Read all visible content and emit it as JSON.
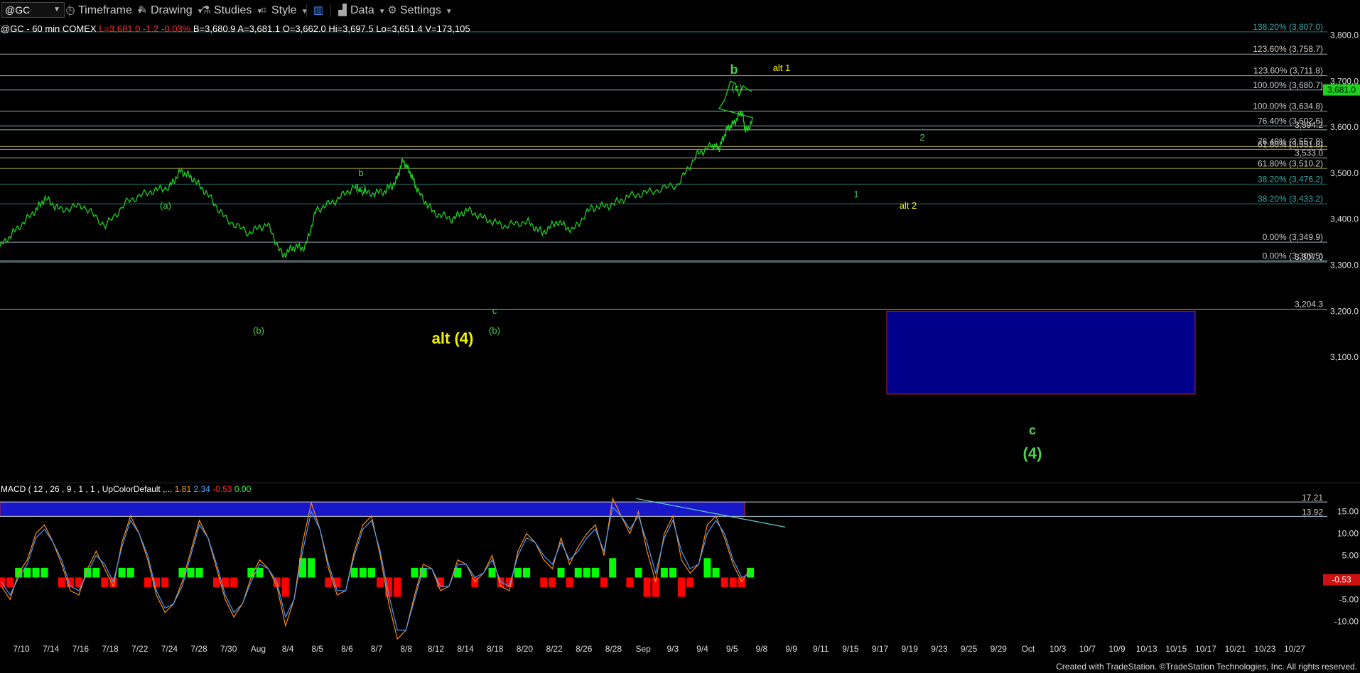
{
  "toolbar": {
    "symbol": "@GC",
    "items": [
      {
        "label": "Timeframe",
        "icon": "clock-icon"
      },
      {
        "label": "Drawing",
        "icon": "pencil-icon"
      },
      {
        "label": "Studies",
        "icon": "flask-icon"
      },
      {
        "label": "Style",
        "icon": "chart-style-icon"
      },
      {
        "label": "",
        "icon": "layout-icon"
      },
      {
        "label": "Data",
        "icon": "bar-chart-icon"
      },
      {
        "label": "Settings",
        "icon": "gear-icon"
      }
    ]
  },
  "quote": {
    "symbol_line": "@GC - 60 min  COMEX",
    "last": "L=3,681.0",
    "chg": "-1.2",
    "pct": "-0.03%",
    "bid": "B=3,680.9",
    "ask": "A=3,681.1",
    "open": "O=3,662.0",
    "hi": "Hi=3,697.5",
    "lo": "Lo=3,651.4",
    "vol": "V=173,105"
  },
  "macd_header": {
    "label": "MACD ( 12 , 26 , 9 , 1 , 1 , UpColorDefault ,...",
    "v1": "1.81",
    "v2": "2.34",
    "v3": "-0.53",
    "v4": "0.00"
  },
  "footer": "Created with TradeStation. ©TradeStation Technologies, Inc. All rights reserved.",
  "colors": {
    "price": "#1fd01f",
    "macd_line": "#ff8c1a",
    "signal_line": "#4a9cff",
    "hist_up": "#00ff00",
    "hist_down": "#ff0000",
    "box": "#00008b",
    "wave_green": "#4cd04c",
    "wave_yellow": "#f2f200"
  },
  "chart_data": [
    {
      "type": "line",
      "y_axis": {
        "range": [
          3020,
          3830
        ],
        "ticks": [
          3100,
          3200,
          3300,
          3400,
          3500,
          3600,
          3700,
          3800
        ],
        "tick_labels": [
          "3,100.0",
          "3,200.0",
          "3,300.0",
          "3,400.0",
          "3,500.0",
          "3,600.0",
          "3,700.0",
          "3,800.0"
        ]
      },
      "x_tick_labels": [
        "7/10",
        "7/14",
        "7/16",
        "7/18",
        "7/22",
        "7/24",
        "7/28",
        "7/30",
        "Aug",
        "8/4",
        "8/5",
        "8/6",
        "8/7",
        "8/8",
        "8/12",
        "8/14",
        "8/18",
        "8/20",
        "8/22",
        "8/26",
        "8/28",
        "Sep",
        "9/3",
        "9/4",
        "9/5",
        "9/8",
        "9/9",
        "9/11",
        "9/15",
        "9/17",
        "9/19",
        "9/23",
        "9/25",
        "9/29",
        "Oct",
        "10/3",
        "10/7",
        "10/9",
        "10/13",
        "10/15",
        "10/17",
        "10/21",
        "10/23",
        "10/27"
      ],
      "price_path": [
        [
          0,
          3340
        ],
        [
          0.02,
          3375
        ],
        [
          0.045,
          3415
        ],
        [
          0.06,
          3445
        ],
        [
          0.08,
          3420
        ],
        [
          0.11,
          3430
        ],
        [
          0.14,
          3385
        ],
        [
          0.17,
          3440
        ],
        [
          0.2,
          3460
        ],
        [
          0.225,
          3470
        ],
        [
          0.24,
          3505
        ],
        [
          0.255,
          3490
        ],
        [
          0.275,
          3455
        ],
        [
          0.3,
          3400
        ],
        [
          0.33,
          3370
        ],
        [
          0.355,
          3390
        ],
        [
          0.375,
          3320
        ],
        [
          0.39,
          3340
        ],
        [
          0.405,
          3338
        ],
        [
          0.42,
          3420
        ],
        [
          0.445,
          3440
        ],
        [
          0.47,
          3470
        ],
        [
          0.49,
          3455
        ],
        [
          0.51,
          3460
        ],
        [
          0.525,
          3480
        ],
        [
          0.535,
          3528
        ],
        [
          0.545,
          3500
        ],
        [
          0.555,
          3460
        ],
        [
          0.575,
          3415
        ],
        [
          0.6,
          3400
        ],
        [
          0.62,
          3420
        ],
        [
          0.645,
          3400
        ],
        [
          0.67,
          3385
        ],
        [
          0.7,
          3395
        ],
        [
          0.72,
          3370
        ],
        [
          0.74,
          3395
        ],
        [
          0.76,
          3375
        ],
        [
          0.785,
          3425
        ],
        [
          0.81,
          3430
        ],
        [
          0.835,
          3450
        ],
        [
          0.865,
          3460
        ],
        [
          0.9,
          3475
        ],
        [
          0.925,
          3540
        ],
        [
          0.945,
          3560
        ],
        [
          0.955,
          3555
        ],
        [
          0.965,
          3595
        ],
        [
          0.975,
          3610
        ],
        [
          0.985,
          3635
        ],
        [
          0.99,
          3590
        ],
        [
          1.0,
          3615
        ]
      ],
      "price_path_note": "",
      "current_price_label": "3,681.0",
      "fib_levels": [
        {
          "label": "138.20% (3,807.0)",
          "value": 3807.0,
          "color": "#2a8a8a"
        },
        {
          "label": "123.60% (3,758.7)",
          "value": 3758.7,
          "color": "#b0c8d8"
        },
        {
          "label": "123.60% (3,711.8)",
          "value": 3711.8,
          "color": "#b0c8d8"
        },
        {
          "label": "100.00% (3,680.7)",
          "value": 3680.7,
          "color": "#b0c8d8"
        },
        {
          "label": "100.00% (3,634.8)",
          "value": 3634.8,
          "color": "#b0c8d8"
        },
        {
          "label": "76.40% (3,602.6)",
          "value": 3602.6,
          "color": "#b0c8d8"
        },
        {
          "label": "3,594.2",
          "value": 3594.2,
          "color": "#b0c8d8"
        },
        {
          "label": "76.40% (3,557.8)",
          "value": 3557.8,
          "color": "#c8c060"
        },
        {
          "label": "61.80% (3,551.8)",
          "value": 3551.8,
          "color": "#c8c060"
        },
        {
          "label": "3,533.0",
          "value": 3533.0,
          "color": "#d0d0d0"
        },
        {
          "label": "61.80% (3,510.2)",
          "value": 3510.2,
          "color": "#b0a840"
        },
        {
          "label": "38.20% (3,476.2)",
          "value": 3476.2,
          "color": "#2a8a8a"
        },
        {
          "label": "38.20% (3,433.2)",
          "value": 3433.2,
          "color": "#2a8a8a"
        },
        {
          "label": "0.00% (3,349.9)",
          "value": 3349.9,
          "color": "#b0c8d8"
        },
        {
          "label": "0.00% (3,309.5)",
          "value": 3309.5,
          "color": "#b0c8d8"
        },
        {
          "label": "3,307.0",
          "value": 3307.0,
          "color": "#b0c8d8"
        },
        {
          "label": "3,204.3",
          "value": 3204.3,
          "color": "#b0c8d8"
        }
      ],
      "annotations": [
        {
          "text": "(a)",
          "color": "green",
          "size": "small"
        },
        {
          "text": "(b)",
          "color": "green",
          "size": "small"
        },
        {
          "text": "b",
          "color": "green",
          "size": "small"
        },
        {
          "text": "(c)",
          "color": "green",
          "size": "small"
        },
        {
          "text": "c",
          "color": "green",
          "size": "small"
        },
        {
          "text": "(b)",
          "color": "green",
          "size": "small"
        },
        {
          "text": "alt (4)",
          "color": "yellow",
          "size": "big"
        },
        {
          "text": "b",
          "color": "green",
          "size": "medium"
        },
        {
          "text": "(c)",
          "color": "green",
          "size": "small"
        },
        {
          "text": "alt 1",
          "color": "yellow",
          "size": "small"
        },
        {
          "text": "2",
          "color": "green",
          "size": "small"
        },
        {
          "text": "1",
          "color": "green",
          "size": "small"
        },
        {
          "text": "alt 2",
          "color": "yellow",
          "size": "small"
        },
        {
          "text": "c",
          "color": "green",
          "size": "medium"
        },
        {
          "text": "(4)",
          "color": "green",
          "size": "big"
        }
      ],
      "target_box": {
        "y_top": 3200,
        "y_bottom": 3020
      }
    },
    {
      "type": "line",
      "title": "MACD ( 12 , 26 , 9 , 1 , 1 , UpColorDefault ,...",
      "y_axis": {
        "range": [
          -14,
          19
        ],
        "ticks": [
          -10,
          -5,
          5,
          10,
          15
        ],
        "tick_labels": [
          "-10.00",
          "-5.00",
          "5.00",
          "10.00",
          "15.00"
        ]
      },
      "level_labels": [
        {
          "label": "17.21",
          "value": 17.21
        },
        {
          "label": "13.92",
          "value": 13.92
        }
      ],
      "current_label": "-0.53",
      "series": [
        {
          "name": "",
          "values": [
            -2,
            -5,
            1,
            4,
            10,
            12,
            8,
            3,
            -3,
            -4,
            2,
            6,
            2,
            -2,
            8,
            14,
            10,
            4,
            -4,
            -8,
            -6,
            -1,
            6,
            13,
            9,
            2,
            -5,
            -9,
            -6,
            0,
            4,
            2,
            -2,
            -11,
            -5,
            8,
            17,
            11,
            2,
            -4,
            -3,
            6,
            12,
            14,
            5,
            -6,
            -14,
            -12,
            -4,
            3,
            2,
            -3,
            -2,
            4,
            3,
            -1,
            1,
            5,
            -2,
            -3,
            6,
            10,
            8,
            4,
            2,
            9,
            3,
            7,
            10,
            12,
            5,
            18,
            14,
            10,
            15,
            6,
            -1,
            10,
            14,
            4,
            1,
            3,
            12,
            14,
            9,
            3,
            -1,
            2
          ]
        },
        {
          "name": "",
          "values": [
            -1,
            -4,
            0,
            3,
            9,
            11,
            8,
            4,
            -2,
            -3,
            1,
            5,
            3,
            -1,
            7,
            13,
            10,
            5,
            -3,
            -7,
            -6,
            -2,
            5,
            12,
            9,
            3,
            -4,
            -8,
            -6,
            -1,
            3,
            2,
            -1,
            -9,
            -5,
            6,
            15,
            11,
            3,
            -3,
            -3,
            5,
            11,
            13,
            6,
            -4,
            -12,
            -12,
            -5,
            2,
            2,
            -2,
            -2,
            3,
            3,
            0,
            1,
            4,
            -1,
            -2,
            5,
            9,
            8,
            5,
            3,
            8,
            4,
            6,
            9,
            11,
            6,
            16,
            14,
            11,
            14,
            8,
            1,
            9,
            13,
            6,
            2,
            3,
            10,
            13,
            10,
            4,
            0,
            1
          ]
        },
        {
          "name": "",
          "values": [
            -1,
            -1,
            1,
            1,
            1,
            1,
            0,
            -1,
            -1,
            -1,
            1,
            1,
            -1,
            -1,
            1,
            1,
            0,
            -1,
            -1,
            -1,
            0,
            1,
            1,
            1,
            0,
            -1,
            -1,
            -1,
            0,
            1,
            1,
            0,
            -1,
            -2,
            0,
            2,
            2,
            0,
            -1,
            -1,
            0,
            1,
            1,
            1,
            -1,
            -2,
            -2,
            0,
            1,
            1,
            0,
            -1,
            0,
            1,
            0,
            -1,
            0,
            1,
            -1,
            -1,
            1,
            1,
            0,
            -1,
            -1,
            1,
            -1,
            1,
            1,
            1,
            -1,
            2,
            0,
            -1,
            1,
            -2,
            -2,
            1,
            1,
            -2,
            -1,
            0,
            2,
            1,
            -1,
            -1,
            -1,
            1
          ]
        }
      ]
    }
  ]
}
